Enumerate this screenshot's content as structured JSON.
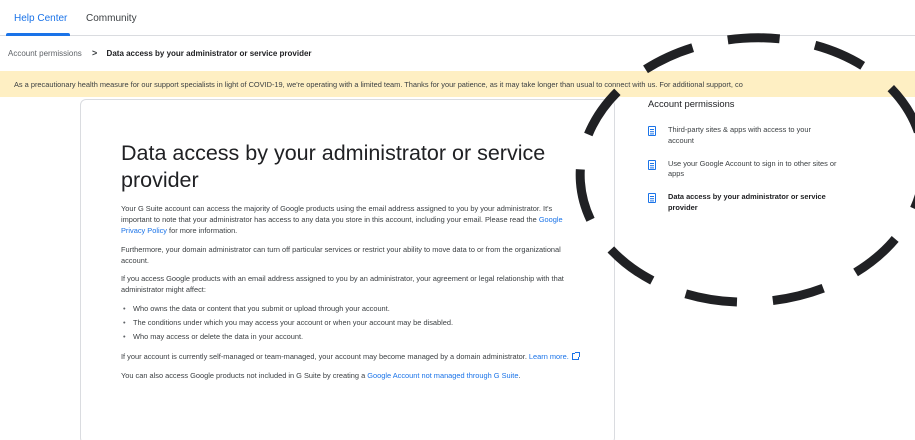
{
  "nav": {
    "tabs": [
      {
        "label": "Help Center",
        "active": true
      },
      {
        "label": "Community",
        "active": false
      }
    ]
  },
  "breadcrumb": {
    "parent": "Account permissions",
    "current": "Data access by your administrator or service provider"
  },
  "banner": {
    "text": "As a precautionary health measure for our support specialists in light of COVID-19, we're operating with a limited team. Thanks for your patience, as it may take longer than usual to connect with us. For additional support, co"
  },
  "article": {
    "title": "Data access by your administrator or service provider",
    "p1_text": "Your G Suite account can access the majority of Google products using the email address assigned to you by your administrator. It's important to note that your administrator has access to any data you store in this account, including your email. Please read the ",
    "p1_link": "Google Privacy Policy",
    "p1_end": " for more information.",
    "p2": "Furthermore, your domain administrator can turn off particular services or restrict your ability to move data to or from the organizational account.",
    "p3": "If you access Google products with an email address assigned to you by an administrator, your agreement or legal relationship with that administrator might affect:",
    "bullets": [
      "Who owns the data or content that you submit or upload through your account.",
      "The conditions under which you may access your account or when your account may be disabled.",
      "Who may access or delete the data in your account."
    ],
    "p4_text": "If your account is currently self-managed or team-managed, your account may become managed by a domain administrator. ",
    "p4_link": "Learn more.",
    "p5_text": "You can also access Google products not included in G Suite by creating a ",
    "p5_link": "Google Account not managed through G Suite",
    "p5_end": "."
  },
  "sidebar": {
    "heading": "Account permissions",
    "items": [
      {
        "label": "Third-party sites & apps with access to your account",
        "icon": "document-icon",
        "current": false
      },
      {
        "label": "Use your Google Account to sign in to other sites or apps",
        "icon": "document-icon",
        "current": false
      },
      {
        "label": "Data access by your administrator or service provider",
        "icon": "document-icon",
        "current": true
      }
    ]
  },
  "colors": {
    "accent": "#1a73e8",
    "banner_bg": "#feefc3",
    "text": "#3c4043",
    "heading": "#202124",
    "annotation": "#202124"
  },
  "annotation": {
    "shape": "dashed-ellipse",
    "encloses": "sidebar"
  }
}
